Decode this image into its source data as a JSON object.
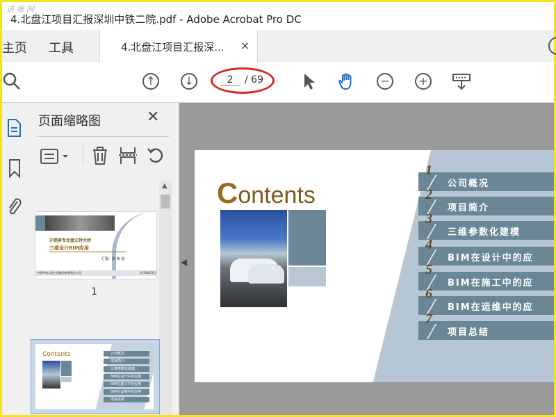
{
  "window": {
    "watermark": "道 振 网",
    "title": "4.北盘江项目汇报深圳中铁二院.pdf - Adobe Acrobat Pro DC"
  },
  "tabs": {
    "home": "主页",
    "tools": "工具",
    "document": "4.北盘江项目汇报深...",
    "close": "×"
  },
  "toolbar": {
    "current_page": "2",
    "total_pages": "/ 69",
    "icons": [
      "search-icon",
      "prev-page-icon",
      "next-page-icon",
      "select-arrow-icon",
      "hand-tool-icon",
      "zoom-out-icon",
      "zoom-in-icon",
      "keyboard-icon"
    ]
  },
  "thumbnails": {
    "header": "页面缩略图",
    "close": "✕",
    "page1_label": "1",
    "page1": {
      "line1": "沪昆客专北盘江特大桥",
      "line2": "三维设计BIM应用",
      "reporter": "汇报：杨 炜 强",
      "org": "中国中铁二院工程集团有限责任公司",
      "date": "2016年03月"
    },
    "page2": {
      "title": "Contents",
      "items": [
        "公司概况",
        "项目简介",
        "三维参数化建模",
        "BIM在设计中的应用",
        "BIM在施工中的应用",
        "BIM在运维中的应用",
        "项目总结"
      ]
    }
  },
  "document": {
    "contents_initial": "C",
    "contents_rest": "ontents",
    "items": [
      {
        "num": "1",
        "text": "公司概况"
      },
      {
        "num": "2",
        "text": "项目简介"
      },
      {
        "num": "3",
        "text": "三维参数化建模"
      },
      {
        "num": "4",
        "text": "BIM在设计中的应"
      },
      {
        "num": "5",
        "text": "BIM在施工中的应"
      },
      {
        "num": "6",
        "text": "BIM在运维中的应"
      },
      {
        "num": "7",
        "text": "项目总结"
      }
    ]
  },
  "colors": {
    "highlight_frame": "#f4e21b",
    "page_indicator_oval": "#dd2222",
    "contents_accent": "#9a6a1f",
    "item_bar": "#6b8795"
  }
}
